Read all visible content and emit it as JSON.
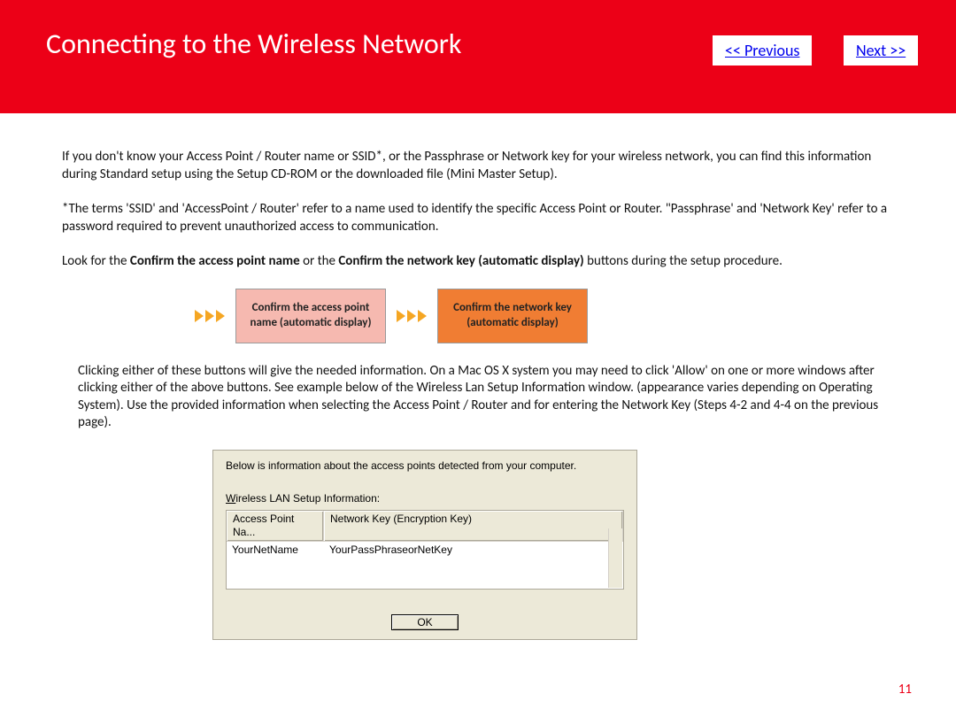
{
  "header": {
    "title": "Connecting to the Wireless Network",
    "prev_label": "<< Previous",
    "next_label": "Next >>"
  },
  "body": {
    "p1": "If you don't know your Access Point / Router name or SSID*, or the Passphrase or Network key for your wireless network, you can find this information during Standard setup using the Setup CD-ROM or the downloaded file (Mini Master Setup).",
    "p2": "*The terms 'SSID' and 'AccessPoint / Router' refer to a name used to identify the specific Access Point or Router. \"Passphrase' and 'Network Key' refer to a password required to prevent unauthorized access to communication.",
    "p3_pre": "Look for the ",
    "p3_b1": "Confirm the access point name",
    "p3_mid": " or the ",
    "p3_b2": "Confirm the network key (automatic display)",
    "p3_post": " buttons during the setup procedure.",
    "confirm_ap": "Confirm the access point name (automatic display)",
    "confirm_key": "Confirm the network key (automatic display)",
    "p4": "Clicking either of these buttons will give the needed information. On a Mac OS X system you may need to click 'Allow' on one or more windows after clicking either of the above buttons. See example below of the Wireless Lan Setup Information window. (appearance varies depending on Operating System). Use the provided information when selecting the Access Point / Router and for entering the Network Key (Steps 4-2 and 4-4 on the previous page)."
  },
  "dialog": {
    "msg": "Below is information about the access points detected from your computer.",
    "label_rest": "ireless LAN Setup Information:",
    "col1": "Access Point Na...",
    "col2": "Network Key (Encryption Key)",
    "row_ap": "YourNetName",
    "row_key": "YourPassPhraseorNetKey",
    "ok": "OK"
  },
  "page_num": "11"
}
